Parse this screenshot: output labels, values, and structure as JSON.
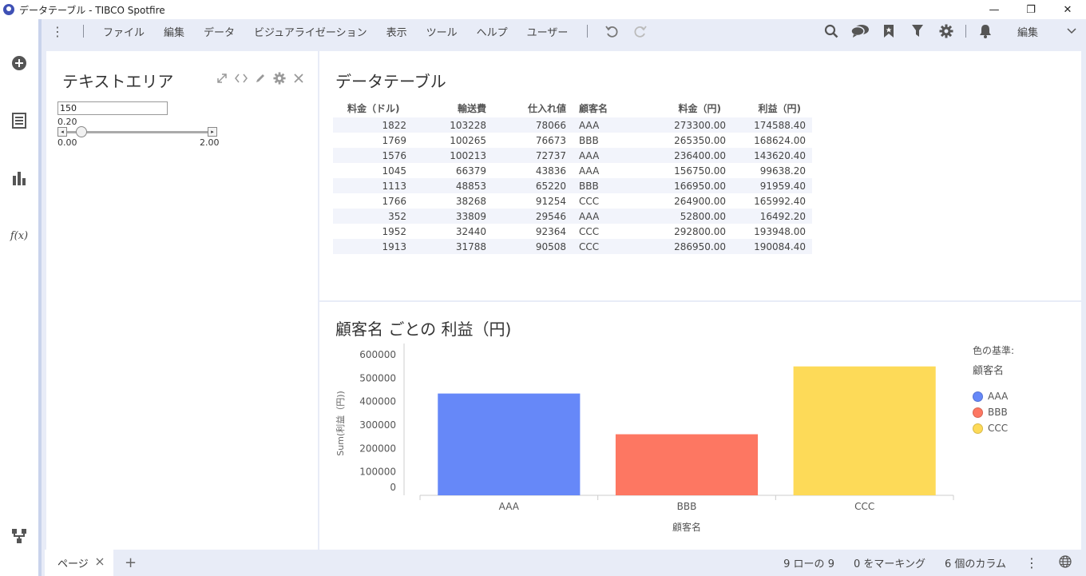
{
  "window": {
    "title": "データテーブル - TIBCO Spotfire",
    "minimize": "—",
    "restore": "❐",
    "close": "✕"
  },
  "menu": {
    "items": [
      "ファイル",
      "編集",
      "データ",
      "ビジュアライゼーション",
      "表示",
      "ツール",
      "ヘルプ",
      "ユーザー"
    ],
    "mode_select": "編集"
  },
  "text_area": {
    "title": "テキストエリア",
    "input_value": "150",
    "slider_value": "0.20",
    "slider_min": "0.00",
    "slider_max": "2.00",
    "slider_fraction": 0.1
  },
  "data_table": {
    "title": "データテーブル",
    "columns": [
      "料金（ドル)",
      "輸送費",
      "仕入れ値",
      "顧客名",
      "料金（円)",
      "利益（円)"
    ],
    "rows": [
      [
        "1822",
        "103228",
        "78066",
        "AAA",
        "273300.00",
        "174588.40"
      ],
      [
        "1769",
        "100265",
        "76673",
        "BBB",
        "265350.00",
        "168624.00"
      ],
      [
        "1576",
        "100213",
        "72737",
        "AAA",
        "236400.00",
        "143620.40"
      ],
      [
        "1045",
        "66379",
        "43836",
        "AAA",
        "156750.00",
        "99638.20"
      ],
      [
        "1113",
        "48853",
        "65220",
        "BBB",
        "166950.00",
        "91959.40"
      ],
      [
        "1766",
        "38268",
        "91254",
        "CCC",
        "264900.00",
        "165992.40"
      ],
      [
        "352",
        "33809",
        "29546",
        "AAA",
        "52800.00",
        "16492.20"
      ],
      [
        "1952",
        "32440",
        "92364",
        "CCC",
        "292800.00",
        "193948.00"
      ],
      [
        "1913",
        "31788",
        "90508",
        "CCC",
        "286950.00",
        "190084.40"
      ]
    ]
  },
  "chart_data": {
    "type": "bar",
    "title": "顧客名 ごとの 利益（円)",
    "categories": [
      "AAA",
      "BBB",
      "CCC"
    ],
    "values": [
      434339.2,
      260583.4,
      550024.8
    ],
    "colors": [
      "#6688f8",
      "#fd7762",
      "#fdda58"
    ],
    "xlabel": "顧客名",
    "ylabel": "Sum(利益（円))",
    "yticks": [
      0,
      100000,
      200000,
      300000,
      400000,
      500000,
      600000
    ],
    "ylim": [
      0,
      600000
    ],
    "legend": {
      "title": "色の基準:",
      "field": "顧客名",
      "position": "right"
    }
  },
  "bottom": {
    "page_tab": "ページ",
    "add_page": "+",
    "row_count": "9 ローの 9",
    "marked": "0 をマーキング",
    "columns": "6 個のカラム"
  }
}
